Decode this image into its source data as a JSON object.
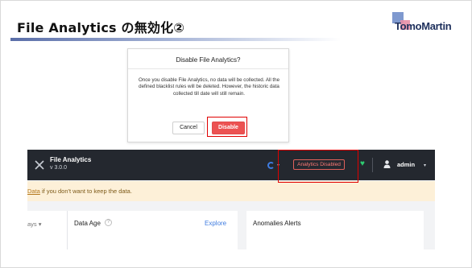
{
  "slide": {
    "title": "File Analytics の無効化②",
    "logo_text": "TomoMartin"
  },
  "dialog": {
    "title": "Disable File Analytics?",
    "body": "Once you disable File Analytics, no data will be collected. All the defined blacklist rules will be deleted. However, the historic data collected till date will still remain.",
    "cancel_label": "Cancel",
    "disable_label": "Disable"
  },
  "app": {
    "name": "File Analytics",
    "version": "v 3.0.0",
    "status_badge": "Analytics Disabled",
    "user": "admin",
    "banner_link": "Data",
    "banner_text": "if you don't want to keep the data.",
    "left_panel_label": "ays",
    "data_age_title": "Data Age",
    "data_age_help": "?",
    "explore_label": "Explore",
    "anomalies_title": "Anomalies Alerts"
  },
  "colors": {
    "accent_red": "#ec5252",
    "header_bg": "#24282f",
    "banner_bg": "#fdf0d8",
    "link_blue": "#3f7ce0",
    "health_green": "#2ecc71"
  },
  "icons": [
    "close-icon",
    "spinner-icon",
    "heart-icon",
    "user-icon",
    "chevron-down-icon",
    "help-icon"
  ]
}
